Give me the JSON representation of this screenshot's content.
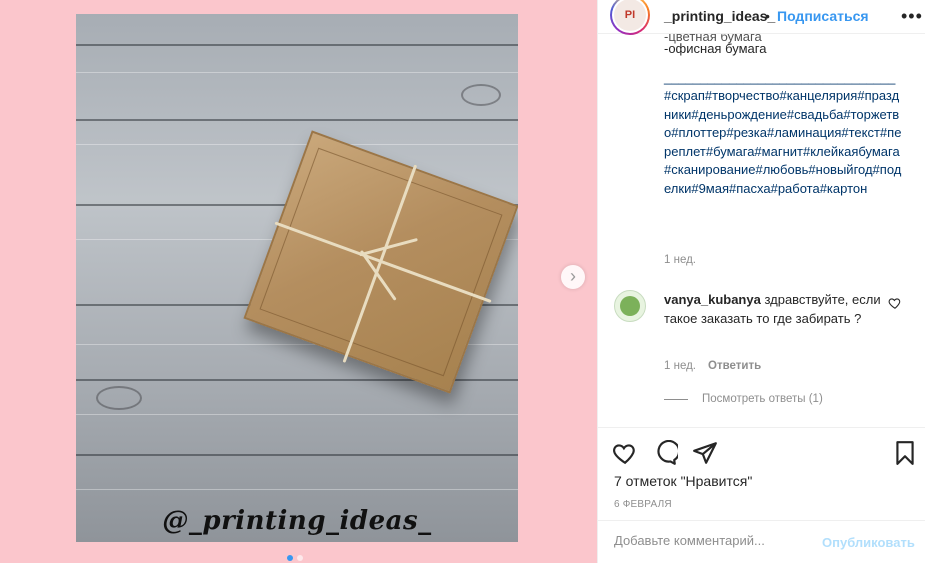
{
  "post": {
    "username": "_printing_ideas_",
    "separator": "•",
    "follow_label": "Подписаться",
    "more_label": "•••",
    "watermark": "@_printing_ideas_",
    "avatar_text": "PI"
  },
  "caption": {
    "cut_line": "-цветная бумага",
    "line1": "-офисная бумага",
    "divider": "________________________________",
    "hashtags": "#скрап#творчество#канцелярия#праздники#деньрождение#свадьба#торжетво#плоттер#резка#ламинация#текст#переплет#бумага#магнит#клейкаябумага#сканирование#любовь#новыйгод#поделки#9мая#пасха#работа#картон",
    "time": "1 нед."
  },
  "comment": {
    "username": "vanya_kubanya",
    "text": " здравствуйте, если такое заказать то где забирать ?",
    "time": "1 нед.",
    "reply_label": "Ответить",
    "view_replies": "Посмотреть ответы (1)"
  },
  "actions": {
    "likes": "7 отметок \"Нравится\"",
    "date": "6 ФЕВРАЛЯ"
  },
  "add_comment": {
    "placeholder": "Добавьте комментарий...",
    "publish_label": "Опубликовать"
  },
  "colors": {
    "background_pink": "#fbc6cc",
    "link_blue": "#3897f0",
    "hashtag_blue": "#003569",
    "muted_gray": "#8e8e8e"
  },
  "carousel": {
    "slides": 2,
    "active_slide": 1
  }
}
